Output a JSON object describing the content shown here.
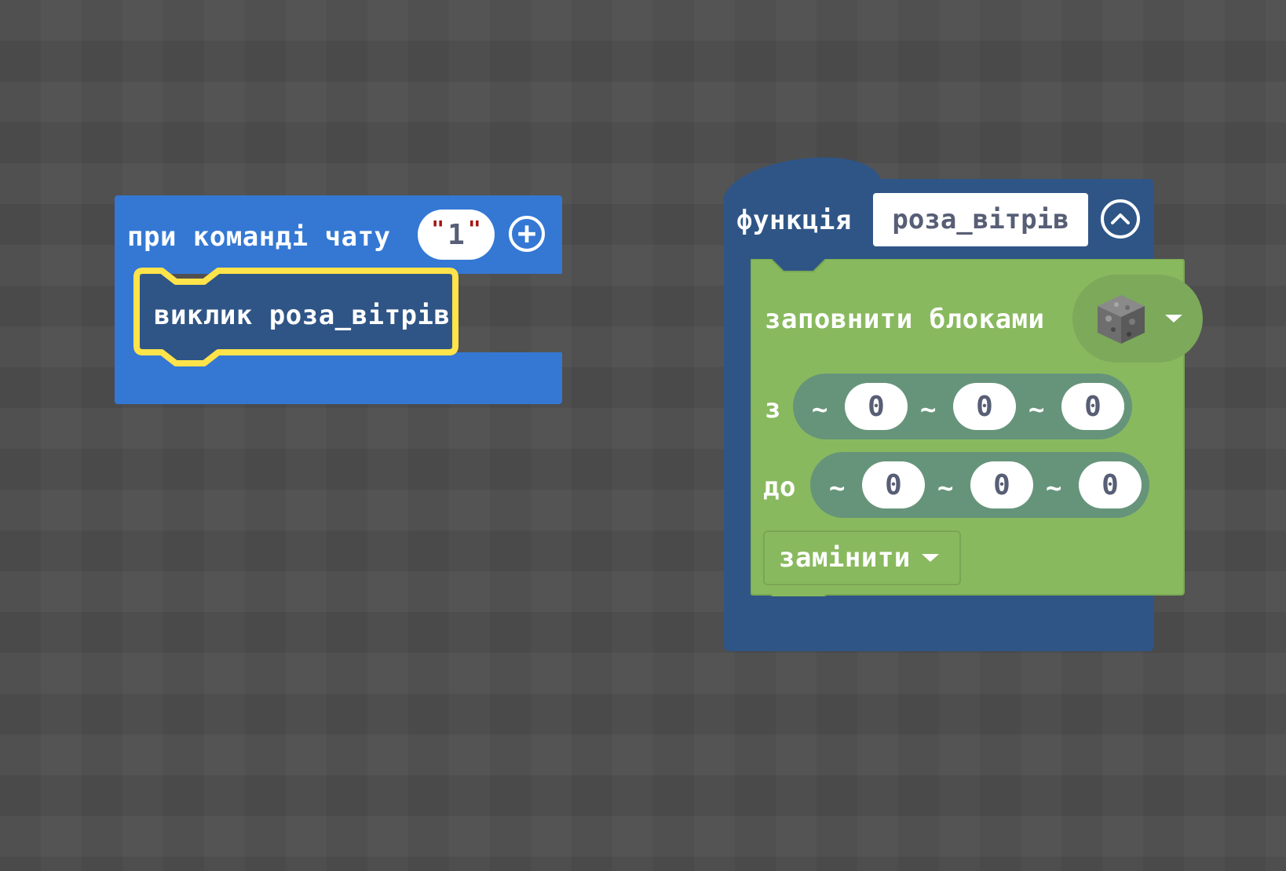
{
  "chat_block": {
    "label": "при команді чату",
    "command_value": "1",
    "quote_open": "\"",
    "quote_close": "\"",
    "add_param_icon": "plus-circle-icon",
    "call_statement": "виклик роза_вітрів"
  },
  "function_block": {
    "label": "функція",
    "name": "роза_вітрів",
    "collapse_icon": "chevron-up-circle-icon",
    "fill": {
      "label": "заповнити блоками",
      "block_type_icon": "cobblestone-block-icon",
      "from_label": "з",
      "to_label": "до",
      "tilde": "~",
      "from": [
        "0",
        "0",
        "0"
      ],
      "to": [
        "0",
        "0",
        "0"
      ],
      "mode": "замінити"
    }
  },
  "colors": {
    "workspace": "#4e4e4e",
    "event_block": "#3478d4",
    "function_block": "#2f5586",
    "fill_block": "#89b95f",
    "position_pill": "#66947a",
    "selection_outline": "#ffe34a"
  }
}
